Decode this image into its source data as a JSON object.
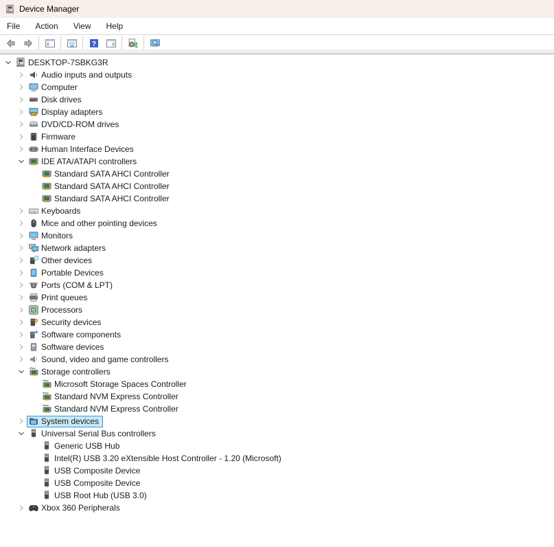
{
  "window": {
    "title": "Device Manager"
  },
  "colors": {
    "titlebar": "#f8eeea",
    "selection_fill": "#cbe8f6",
    "selection_border": "#26a0da"
  },
  "menu": {
    "items": [
      {
        "label": "File"
      },
      {
        "label": "Action"
      },
      {
        "label": "View"
      },
      {
        "label": "Help"
      }
    ]
  },
  "toolbar": {
    "buttons": [
      {
        "name": "back-button",
        "icon": "back-icon"
      },
      {
        "name": "forward-button",
        "icon": "forward-icon"
      },
      {
        "name": "separator"
      },
      {
        "name": "show-hide-console-tree-button",
        "icon": "console-tree-icon"
      },
      {
        "name": "separator"
      },
      {
        "name": "properties-button",
        "icon": "properties-icon"
      },
      {
        "name": "separator"
      },
      {
        "name": "help-button",
        "icon": "help-icon"
      },
      {
        "name": "action-pane-button",
        "icon": "action-pane-icon"
      },
      {
        "name": "separator"
      },
      {
        "name": "scan-for-hardware-changes-button",
        "icon": "scan-hardware-icon"
      },
      {
        "name": "separator"
      },
      {
        "name": "search-devices-button",
        "icon": "devices-search-icon"
      }
    ]
  },
  "tree": {
    "rows": [
      {
        "label": "DESKTOP-7SBKG3R",
        "level": 0,
        "state": "expanded",
        "icon": "device-manager-root-icon",
        "selected": false
      },
      {
        "label": "Audio inputs and outputs",
        "level": 1,
        "state": "collapsed",
        "icon": "audio-icon",
        "selected": false
      },
      {
        "label": "Computer",
        "level": 1,
        "state": "collapsed",
        "icon": "computer-icon",
        "selected": false
      },
      {
        "label": "Disk drives",
        "level": 1,
        "state": "collapsed",
        "icon": "disk-drive-icon",
        "selected": false
      },
      {
        "label": "Display adapters",
        "level": 1,
        "state": "collapsed",
        "icon": "display-adapter-icon",
        "selected": false
      },
      {
        "label": "DVD/CD-ROM drives",
        "level": 1,
        "state": "collapsed",
        "icon": "cd-drive-icon",
        "selected": false
      },
      {
        "label": "Firmware",
        "level": 1,
        "state": "collapsed",
        "icon": "firmware-icon",
        "selected": false
      },
      {
        "label": "Human Interface Devices",
        "level": 1,
        "state": "collapsed",
        "icon": "hid-icon",
        "selected": false
      },
      {
        "label": "IDE ATA/ATAPI controllers",
        "level": 1,
        "state": "expanded",
        "icon": "sata-controller-icon",
        "selected": false
      },
      {
        "label": "Standard SATA AHCI Controller",
        "level": 2,
        "state": "leaf",
        "icon": "sata-controller-icon",
        "selected": false
      },
      {
        "label": "Standard SATA AHCI Controller",
        "level": 2,
        "state": "leaf",
        "icon": "sata-controller-icon",
        "selected": false
      },
      {
        "label": "Standard SATA AHCI Controller",
        "level": 2,
        "state": "leaf",
        "icon": "sata-controller-icon",
        "selected": false
      },
      {
        "label": "Keyboards",
        "level": 1,
        "state": "collapsed",
        "icon": "keyboard-icon",
        "selected": false
      },
      {
        "label": "Mice and other pointing devices",
        "level": 1,
        "state": "collapsed",
        "icon": "mouse-icon",
        "selected": false
      },
      {
        "label": "Monitors",
        "level": 1,
        "state": "collapsed",
        "icon": "monitor-icon",
        "selected": false
      },
      {
        "label": "Network adapters",
        "level": 1,
        "state": "collapsed",
        "icon": "network-icon",
        "selected": false
      },
      {
        "label": "Other devices",
        "level": 1,
        "state": "collapsed",
        "icon": "unknown-device-icon",
        "selected": false
      },
      {
        "label": "Portable Devices",
        "level": 1,
        "state": "collapsed",
        "icon": "portable-device-icon",
        "selected": false
      },
      {
        "label": "Ports (COM & LPT)",
        "level": 1,
        "state": "collapsed",
        "icon": "port-icon",
        "selected": false
      },
      {
        "label": "Print queues",
        "level": 1,
        "state": "collapsed",
        "icon": "printer-icon",
        "selected": false
      },
      {
        "label": "Processors",
        "level": 1,
        "state": "collapsed",
        "icon": "processor-icon",
        "selected": false
      },
      {
        "label": "Security devices",
        "level": 1,
        "state": "collapsed",
        "icon": "security-icon",
        "selected": false
      },
      {
        "label": "Software components",
        "level": 1,
        "state": "collapsed",
        "icon": "software-component-icon",
        "selected": false
      },
      {
        "label": "Software devices",
        "level": 1,
        "state": "collapsed",
        "icon": "software-device-icon",
        "selected": false
      },
      {
        "label": "Sound, video and game controllers",
        "level": 1,
        "state": "collapsed",
        "icon": "sound-icon",
        "selected": false
      },
      {
        "label": "Storage controllers",
        "level": 1,
        "state": "expanded",
        "icon": "storage-controller-icon",
        "selected": false
      },
      {
        "label": "Microsoft Storage Spaces Controller",
        "level": 2,
        "state": "leaf",
        "icon": "storage-controller-icon",
        "selected": false
      },
      {
        "label": "Standard NVM Express Controller",
        "level": 2,
        "state": "leaf",
        "icon": "storage-controller-icon",
        "selected": false
      },
      {
        "label": "Standard NVM Express Controller",
        "level": 2,
        "state": "leaf",
        "icon": "storage-controller-icon",
        "selected": false
      },
      {
        "label": "System devices",
        "level": 1,
        "state": "collapsed",
        "icon": "system-devices-icon",
        "selected": true
      },
      {
        "label": "Universal Serial Bus controllers",
        "level": 1,
        "state": "expanded",
        "icon": "usb-icon",
        "selected": false
      },
      {
        "label": "Generic USB Hub",
        "level": 2,
        "state": "leaf",
        "icon": "usb-icon",
        "selected": false
      },
      {
        "label": "Intel(R) USB 3.20 eXtensible Host Controller - 1.20 (Microsoft)",
        "level": 2,
        "state": "leaf",
        "icon": "usb-icon",
        "selected": false
      },
      {
        "label": "USB Composite Device",
        "level": 2,
        "state": "leaf",
        "icon": "usb-icon",
        "selected": false
      },
      {
        "label": "USB Composite Device",
        "level": 2,
        "state": "leaf",
        "icon": "usb-icon",
        "selected": false
      },
      {
        "label": "USB Root Hub (USB 3.0)",
        "level": 2,
        "state": "leaf",
        "icon": "usb-icon",
        "selected": false
      },
      {
        "label": "Xbox 360 Peripherals",
        "level": 1,
        "state": "collapsed",
        "icon": "xbox-icon",
        "selected": false
      }
    ]
  }
}
